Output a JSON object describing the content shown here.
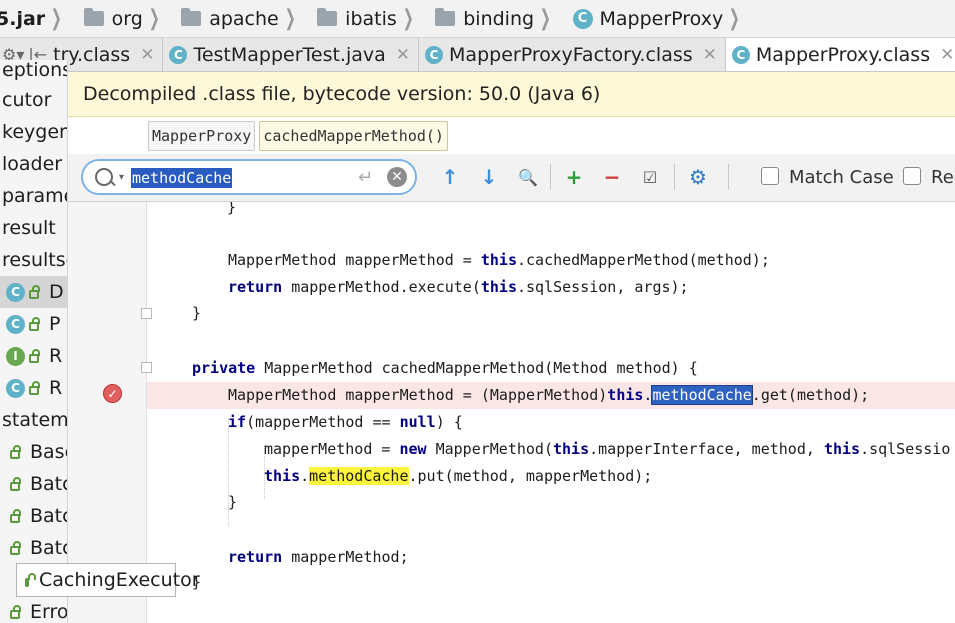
{
  "navbar": {
    "jar": "5.jar",
    "crumbs": [
      "org",
      "apache",
      "ibatis",
      "binding",
      "MapperProxy"
    ]
  },
  "tabs": [
    {
      "label": "try.class",
      "active": false
    },
    {
      "label": "TestMapperTest.java",
      "active": false
    },
    {
      "label": "MapperProxyFactory.class",
      "active": false
    },
    {
      "label": "MapperProxy.class",
      "active": true
    }
  ],
  "tree": {
    "items": [
      "eptions",
      "cutor",
      "keygen",
      "loader",
      "parame",
      "result",
      "resultse",
      "D",
      "P",
      "R",
      "R",
      "stateme",
      "Base",
      "Batch",
      "Batch",
      "Batch",
      "CachingExecutor",
      "Error"
    ],
    "tooltip": "CachingExecutor"
  },
  "banner": {
    "text": "Decompiled .class file, bytecode version: 50.0 (Java 6)"
  },
  "structure": {
    "class_chip": "MapperProxy",
    "method_chip": "cachedMapperMethod()"
  },
  "search": {
    "query": "methodCache",
    "match_case_label": "Match Case",
    "regex_label": "Reg"
  },
  "code": {
    "l0": "}",
    "l2a": "MapperMethod mapperMethod = ",
    "l2kw": "this",
    "l2b": ".cachedMapperMethod(method);",
    "l3kw": "return",
    "l3a": " mapperMethod.execute(",
    "l3kw2": "this",
    "l3b": ".sqlSession, args);",
    "l4": "}",
    "l6kw": "private",
    "l6a": " MapperMethod cachedMapperMethod(Method method) {",
    "l7a": "MapperMethod mapperMethod = (MapperMethod)",
    "l7kw": "this",
    "l7dot": ".",
    "l7hl": "methodCache",
    "l7b": ".get(method);",
    "l8kw": "if",
    "l8a": "(mapperMethod == ",
    "l8kw2": "null",
    "l8b": ") {",
    "l9a": "mapperMethod = ",
    "l9kw": "new",
    "l9b": " MapperMethod(",
    "l9kw2": "this",
    "l9c": ".mapperInterface, method, ",
    "l9kw3": "this",
    "l9d": ".sqlSessio",
    "l10kw": "this",
    "l10dot": ".",
    "l10hl": "methodCache",
    "l10b": ".put(method, mapperMethod);",
    "l11": "}",
    "l13kw": "return",
    "l13a": " mapperMethod;",
    "l14": "}"
  }
}
